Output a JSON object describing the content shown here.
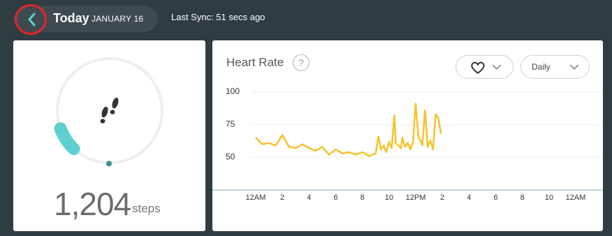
{
  "header": {
    "back_icon": "chevron-left-icon",
    "date_day": "Today",
    "date_month": "JANUARY 16",
    "last_sync": "Last Sync: 51 secs ago"
  },
  "steps": {
    "count": "1,204",
    "unit": "steps",
    "icon": "footprints-icon",
    "progress_fraction": 0.12
  },
  "heart_rate": {
    "title": "Heart Rate",
    "help_icon": "question-icon",
    "metric_icon": "heart-icon",
    "period_selected": "Daily",
    "colors": {
      "line": "#f7c22a",
      "baseline": "#a9c7d1",
      "ring_fill": "#5ed0cf",
      "ring_track": "#eeeeee"
    }
  },
  "chart_data": {
    "type": "line",
    "title": "Heart Rate",
    "y_ticks": [
      "100",
      "75",
      "50"
    ],
    "ylim": [
      25,
      100
    ],
    "x_ticks": [
      "12AM",
      "2",
      "4",
      "6",
      "8",
      "10",
      "12PM",
      "2",
      "4",
      "6",
      "8",
      "10",
      "12AM"
    ],
    "x_hours": [
      0,
      0.5,
      1,
      1.5,
      2,
      2.5,
      3,
      3.5,
      4,
      4.5,
      5,
      5.5,
      6,
      6.5,
      7,
      7.5,
      8,
      8.5,
      9,
      9.2,
      9.4,
      9.6,
      9.8,
      10,
      10.2,
      10.4,
      10.5,
      10.7,
      10.9,
      11,
      11.2,
      11.4,
      11.6,
      11.8,
      12,
      12.2,
      12.4,
      12.5,
      12.7,
      12.9,
      13.1,
      13.3,
      13.5,
      13.7,
      13.9
    ],
    "values": [
      65,
      60,
      61,
      59,
      67,
      58,
      57,
      60,
      57,
      55,
      58,
      52,
      56,
      53,
      54,
      52,
      54,
      51,
      53,
      66,
      56,
      59,
      54,
      62,
      57,
      82,
      61,
      59,
      57,
      65,
      58,
      61,
      56,
      62,
      91,
      66,
      62,
      59,
      86,
      58,
      63,
      56,
      83,
      80,
      68
    ],
    "series": [
      {
        "name": "",
        "values": []
      }
    ]
  }
}
